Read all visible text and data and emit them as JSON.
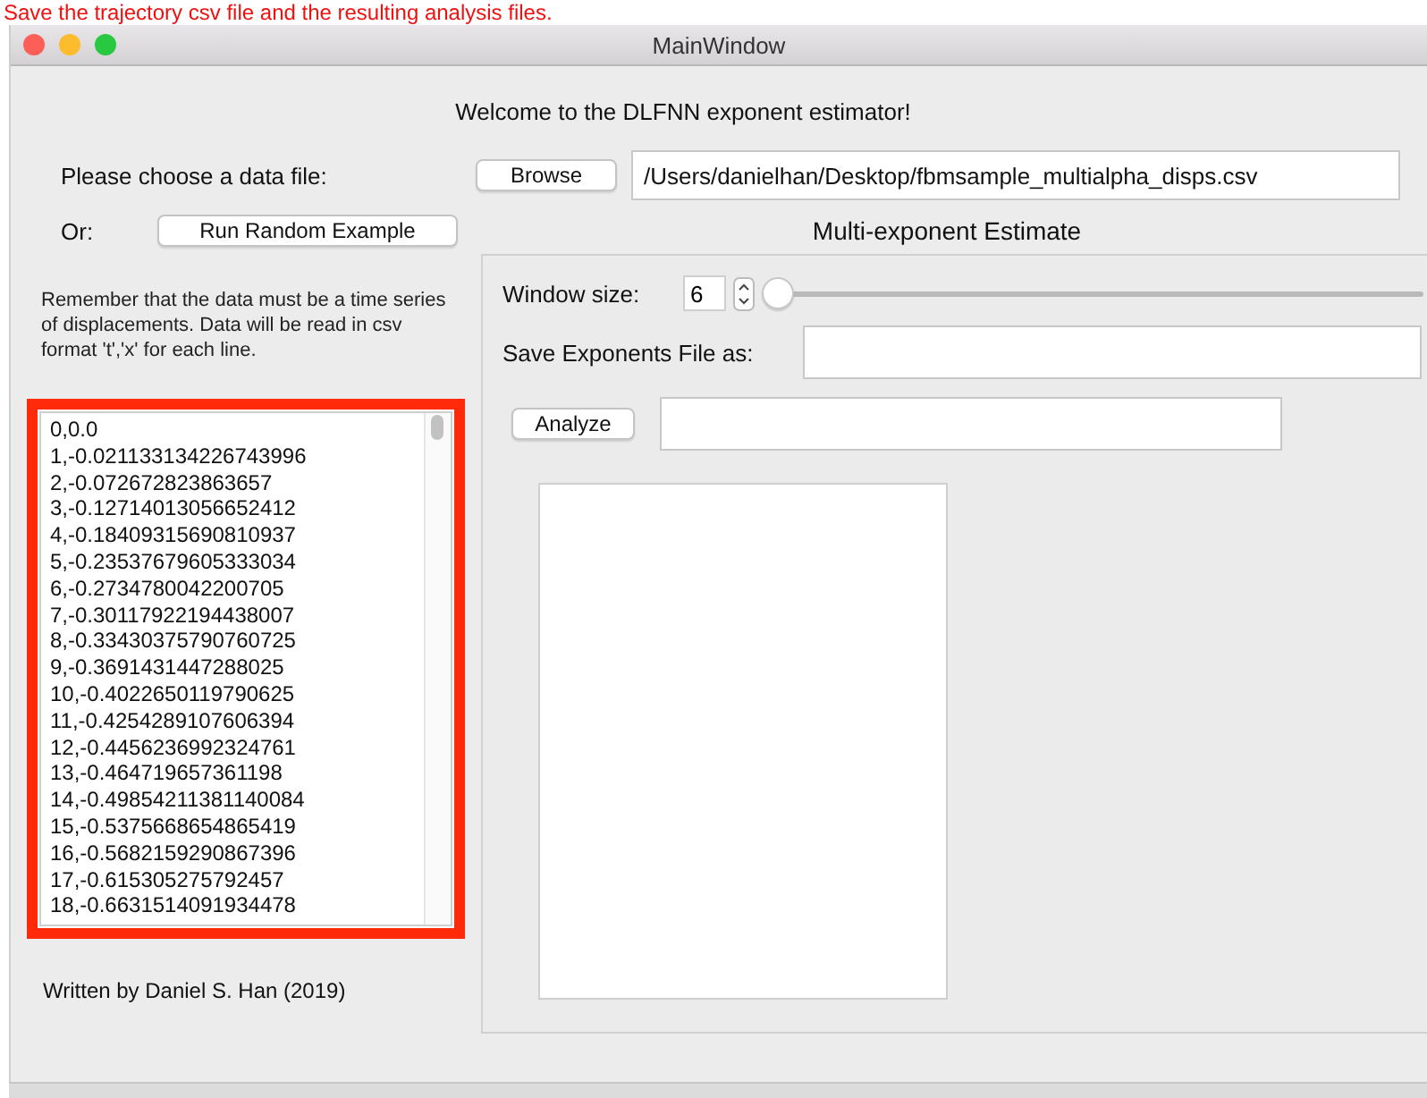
{
  "caption": "Save the trajectory csv file and the resulting analysis files.",
  "window": {
    "title": "MainWindow"
  },
  "welcome": "Welcome to the DLFNN exponent estimator!",
  "file_row": {
    "label": "Please choose a data file:",
    "button": "Browse",
    "path": "/Users/danielhan/Desktop/fbmsample_multialpha_disps.csv"
  },
  "random_row": {
    "label": "Or:",
    "button": "Run Random Example"
  },
  "note": "Remember that the data must be a time series of displacements. Data will be read in csv format 't','x' for each line.",
  "data_lines": [
    "0,0.0",
    "1,-0.021133134226743996",
    "2,-0.072672823863657",
    "3,-0.12714013056652412",
    "4,-0.18409315690810937",
    "5,-0.23537679605333034",
    "6,-0.2734780042200705",
    "7,-0.30117922194438007",
    "8,-0.33430375790760725",
    "9,-0.3691431447288025",
    "10,-0.4022650119790625",
    "11,-0.4254289107606394",
    "12,-0.4456236992324761",
    "13,-0.464719657361198",
    "14,-0.49854211381140084",
    "15,-0.5375668654865419",
    "16,-0.5682159290867396",
    "17,-0.615305275792457",
    "18,-0.6631514091934478"
  ],
  "footer": "Written by Daniel S. Han (2019)",
  "estimate": {
    "title": "Multi-exponent Estimate",
    "window_size_label": "Window size:",
    "window_size": "6",
    "slider": {
      "level": 0
    },
    "save_label": "Save Exponents File as:",
    "analyze_button": "Analyze"
  }
}
